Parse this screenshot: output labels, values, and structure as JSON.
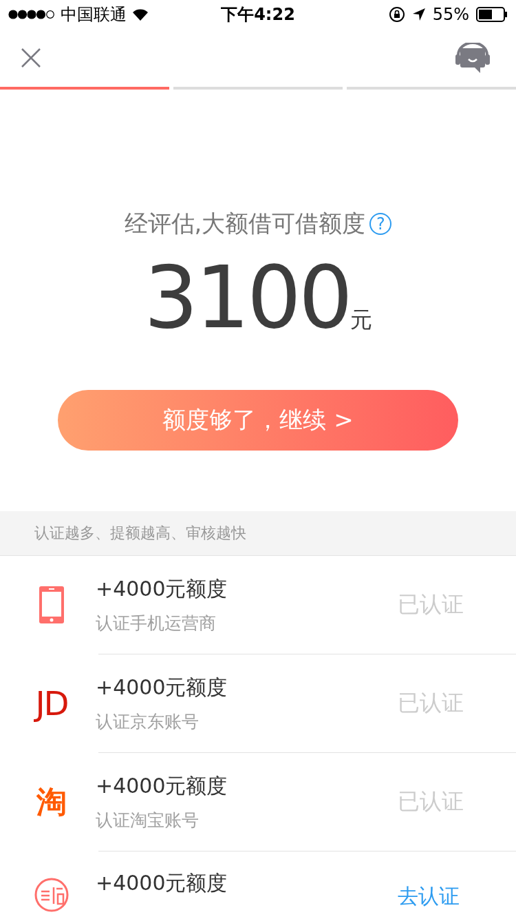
{
  "status_bar": {
    "carrier": "中国联通",
    "time": "下午4:22",
    "battery": "55%"
  },
  "header": {
    "steps": [
      {
        "active": true
      },
      {
        "active": false
      },
      {
        "active": false
      }
    ]
  },
  "quota": {
    "label": "经评估,大额借可借额度",
    "help": "?",
    "amount": "3100",
    "unit": "元",
    "button": "额度够了，继续 >"
  },
  "section_hint": "认证越多、提额越高、审核越快",
  "items": [
    {
      "kind": "phone",
      "title": "+4000元额度",
      "subtitle": "认证手机运营商",
      "status": "已认证",
      "verified": true
    },
    {
      "kind": "jd",
      "logo": "JD",
      "title": "+4000元额度",
      "subtitle": "认证京东账号",
      "status": "已认证",
      "verified": true
    },
    {
      "kind": "taobao",
      "logo": "淘",
      "title": "+4000元额度",
      "subtitle": "认证淘宝账号",
      "status": "已认证",
      "verified": true
    },
    {
      "kind": "seal",
      "title": "+4000元额度",
      "status": "去认证",
      "verified": false
    }
  ]
}
